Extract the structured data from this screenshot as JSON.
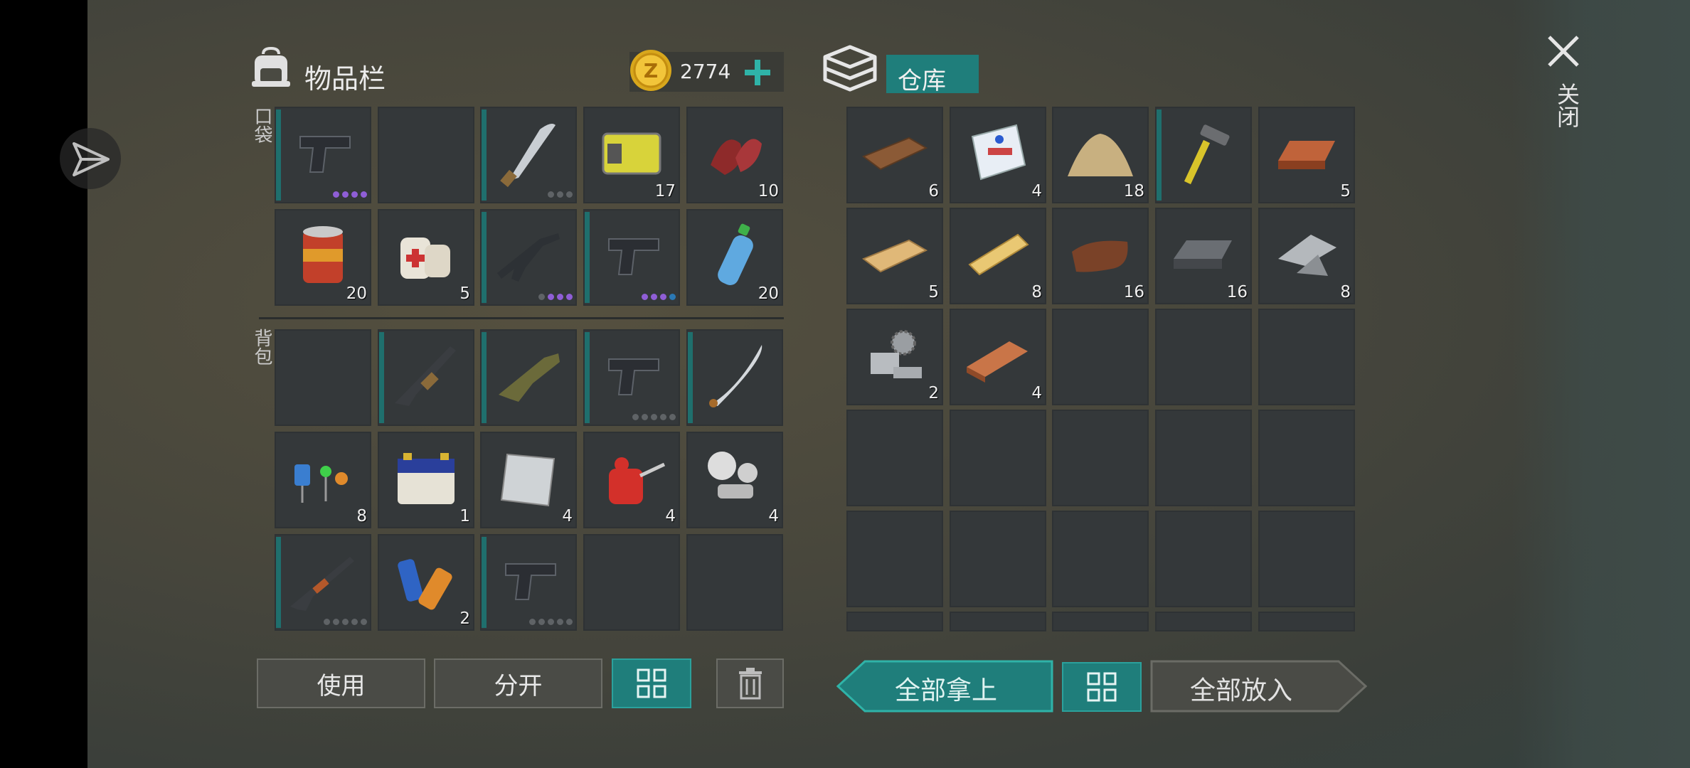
{
  "inventory": {
    "title": "物品栏",
    "pocket_label": "口袋",
    "backpack_label": "背包",
    "coins": "2774",
    "pocket": [
      {
        "icon": "pistol-icon",
        "qty": "",
        "dots": "pppp"
      },
      {
        "icon": "",
        "qty": "",
        "dots": ""
      },
      {
        "icon": "machete-icon",
        "qty": "",
        "dots": "ggg"
      },
      {
        "icon": "battery-pack-icon",
        "qty": "17",
        "dots": ""
      },
      {
        "icon": "meat-icon",
        "qty": "10",
        "dots": ""
      },
      {
        "icon": "food-can-icon",
        "qty": "20",
        "dots": ""
      },
      {
        "icon": "bandage-icon",
        "qty": "5",
        "dots": ""
      },
      {
        "icon": "assault-rifle-icon",
        "qty": "",
        "dots": "gppp"
      },
      {
        "icon": "pistol-icon",
        "qty": "",
        "dots": "pppb"
      },
      {
        "icon": "water-bottle-icon",
        "qty": "20",
        "dots": ""
      }
    ],
    "backpack": [
      {
        "icon": "",
        "qty": "",
        "dots": ""
      },
      {
        "icon": "rifle-icon",
        "qty": "",
        "dots": ""
      },
      {
        "icon": "grenade-launcher-icon",
        "qty": "",
        "dots": ""
      },
      {
        "icon": "pistol-icon",
        "qty": "",
        "dots": "ggggg"
      },
      {
        "icon": "katana-icon",
        "qty": "",
        "dots": ""
      },
      {
        "icon": "electronic-components-icon",
        "qty": "8",
        "dots": ""
      },
      {
        "icon": "car-battery-icon",
        "qty": "1",
        "dots": ""
      },
      {
        "icon": "steel-plate-icon",
        "qty": "4",
        "dots": ""
      },
      {
        "icon": "oil-can-icon",
        "qty": "4",
        "dots": ""
      },
      {
        "icon": "mechanical-parts-icon",
        "qty": "4",
        "dots": ""
      },
      {
        "icon": "shotgun-icon",
        "qty": "",
        "dots": "ggggg"
      },
      {
        "icon": "batteries-icon",
        "qty": "2",
        "dots": ""
      },
      {
        "icon": "pistol-icon",
        "qty": "",
        "dots": "ggggg"
      },
      {
        "icon": "",
        "qty": "",
        "dots": ""
      },
      {
        "icon": "",
        "qty": "",
        "dots": ""
      }
    ],
    "buttons": {
      "use": "使用",
      "split": "分开"
    }
  },
  "storage": {
    "title": "仓库",
    "slots": [
      {
        "icon": "wooden-plank-icon",
        "qty": "6"
      },
      {
        "icon": "cement-bag-icon",
        "qty": "4"
      },
      {
        "icon": "sand-pile-icon",
        "qty": "18"
      },
      {
        "icon": "hammer-icon",
        "qty": ""
      },
      {
        "icon": "copper-ingot-icon",
        "qty": "5"
      },
      {
        "icon": "birch-plank-icon",
        "qty": "5"
      },
      {
        "icon": "pine-plank-icon",
        "qty": "8"
      },
      {
        "icon": "leather-icon",
        "qty": "16"
      },
      {
        "icon": "iron-ingot-icon",
        "qty": "16"
      },
      {
        "icon": "scrap-metal-icon",
        "qty": "8"
      },
      {
        "icon": "gear-parts-icon",
        "qty": "2"
      },
      {
        "icon": "clay-brick-icon",
        "qty": "4"
      }
    ],
    "buttons": {
      "take_all": "全部拿上",
      "put_all": "全部放入"
    }
  },
  "close_label": "关闭",
  "colors": {
    "teal": "#1f7e7b",
    "slot": "#34383a",
    "purple_dot": "#8f5ed6",
    "blue_dot": "#2a78b5"
  }
}
